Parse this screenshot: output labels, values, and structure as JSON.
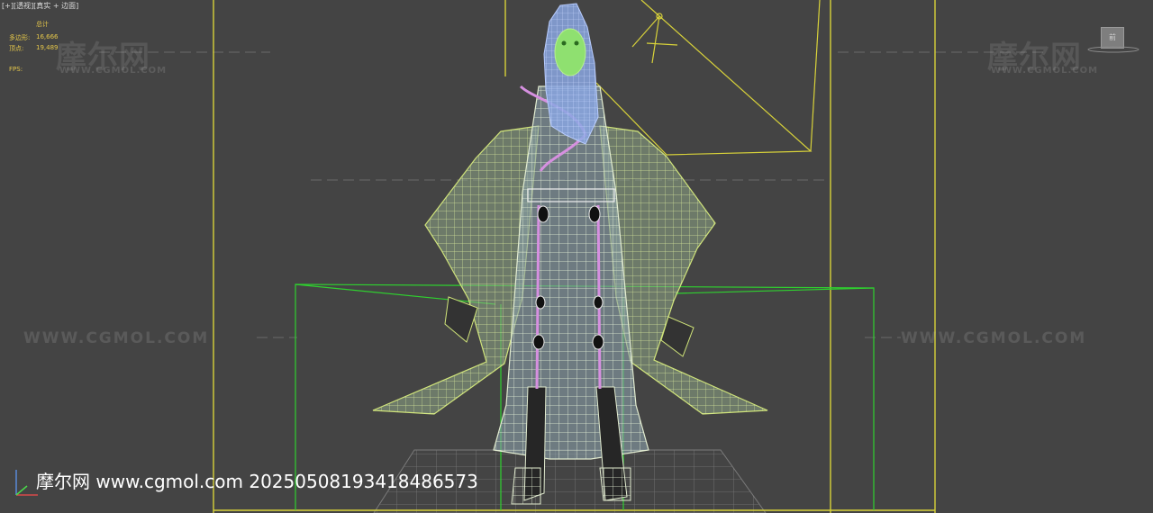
{
  "viewport": {
    "label": "[+][透视][真实 + 边面]"
  },
  "stats": {
    "header": "总计",
    "polys_label": "多边形:",
    "polys_value": "16,666",
    "verts_label": "顶点:",
    "verts_value": "19,489",
    "fps_label": "FPS:"
  },
  "watermark": {
    "brand_cn": "摩尔网",
    "brand_url": "WWW.CGMOL.COM",
    "row_text": "WWW.CGMOL.COM"
  },
  "footer": {
    "text": "摩尔网 www.cgmol.com 20250508193418486573"
  },
  "viewcube": {
    "label": "前"
  },
  "colors": {
    "background": "#444444",
    "selection_yellow": "#d8d23a",
    "helper_green": "#2fd12f",
    "wire_lightgreen": "#d8ee8c",
    "skin_green": "#8fe070",
    "hair_blue": "#8aa6e0",
    "bone_pink": "#d690e0"
  },
  "icons": [
    "axis-gizmo-icon",
    "viewcube-icon",
    "camera-gizmo-icon"
  ]
}
